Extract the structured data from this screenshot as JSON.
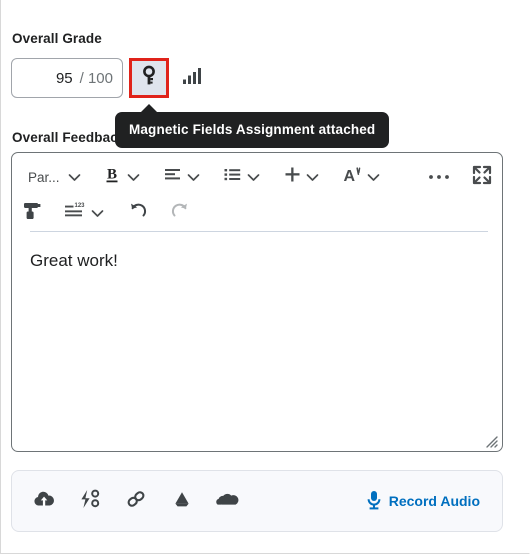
{
  "grade": {
    "label": "Overall Grade",
    "value": "95",
    "denominator": "/ 100",
    "attachment_button_name": "rubric-key-icon",
    "stats_button_name": "grade-statistics-icon",
    "highlight_color": "#e0231a",
    "attachment_button_bg": "#dfe4ed"
  },
  "tooltip": {
    "text": "Magnetic Fields Assignment attached",
    "background": "#202122",
    "text_color": "#ffffff"
  },
  "feedback": {
    "label": "Overall Feedback",
    "body_text": "Great work!"
  },
  "toolbar": {
    "row1": [
      {
        "name": "paragraph-format-dropdown",
        "label": "Par...",
        "type": "text-dropdown"
      },
      {
        "name": "bold-button",
        "label": "B",
        "type": "icon-dropdown"
      },
      {
        "name": "align-left-button",
        "label": "",
        "type": "icon-dropdown"
      },
      {
        "name": "bulleted-list-button",
        "label": "",
        "type": "icon-dropdown"
      },
      {
        "name": "insert-button",
        "label": "+",
        "type": "icon-dropdown"
      },
      {
        "name": "font-style-button",
        "label": "A",
        "type": "icon-dropdown"
      },
      {
        "name": "more-options-button",
        "label": "",
        "type": "icon"
      },
      {
        "name": "fullscreen-button",
        "label": "",
        "type": "icon"
      }
    ],
    "row2": [
      {
        "name": "format-painter-button",
        "label": "",
        "type": "icon"
      },
      {
        "name": "numbering-123-button",
        "label": "123",
        "type": "icon-dropdown"
      },
      {
        "name": "undo-button",
        "label": "",
        "type": "icon"
      },
      {
        "name": "redo-button",
        "label": "",
        "type": "icon",
        "disabled": true
      }
    ]
  },
  "attachments": {
    "items": [
      {
        "name": "upload-file-icon",
        "title": "Upload File"
      },
      {
        "name": "quicklink-icon",
        "title": "Insert Quicklink"
      },
      {
        "name": "link-icon",
        "title": "Insert Link"
      },
      {
        "name": "google-drive-icon",
        "title": "Google Drive"
      },
      {
        "name": "onedrive-icon",
        "title": "OneDrive"
      }
    ],
    "record_audio_label": "Record Audio",
    "record_audio_color": "#006fbf"
  }
}
